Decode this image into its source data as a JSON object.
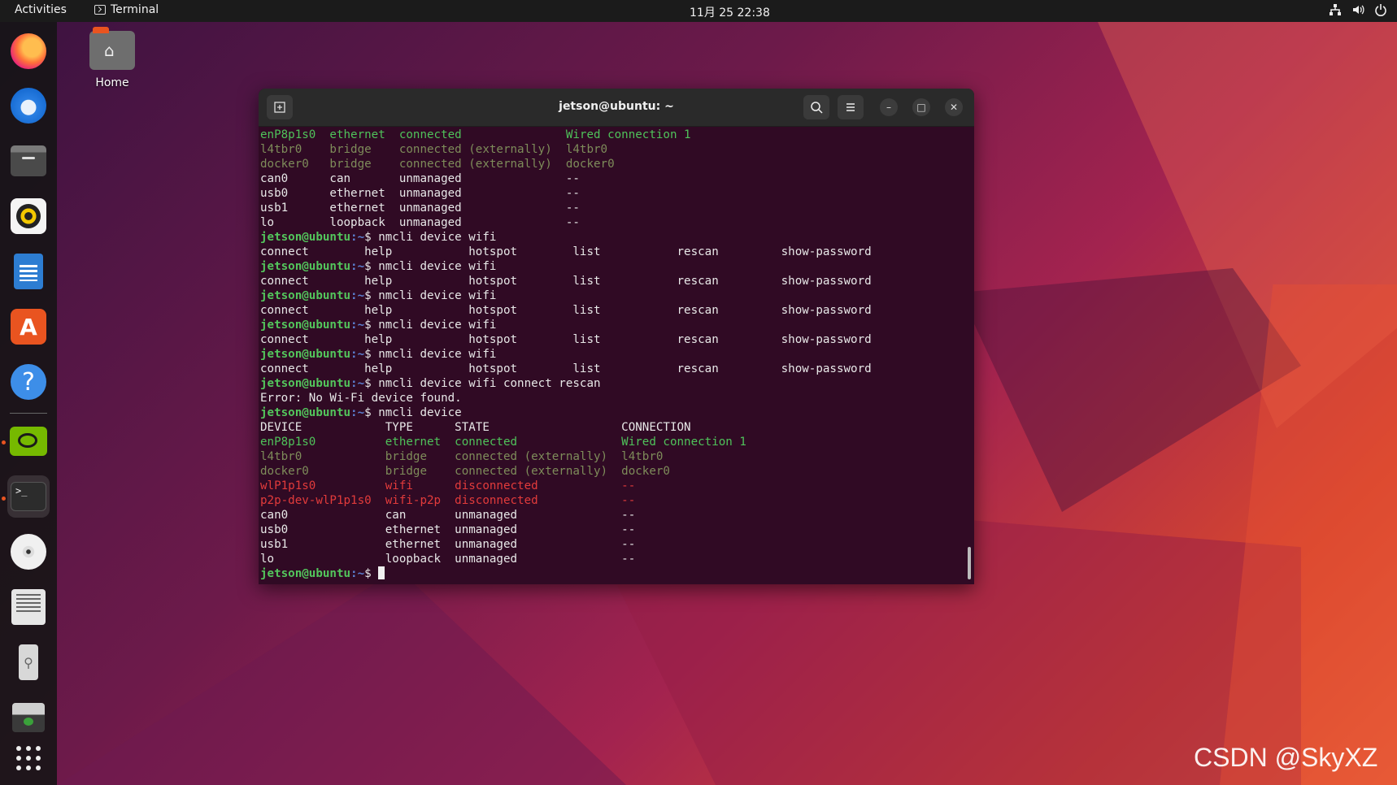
{
  "topbar": {
    "activities": "Activities",
    "app_name": "Terminal",
    "clock": "11月 25  22:38"
  },
  "desktop": {
    "home_label": "Home",
    "watermark": "CSDN @SkyXZ～"
  },
  "dock": {
    "items": [
      {
        "name": "firefox",
        "icon": "firefox-icon"
      },
      {
        "name": "thunderbird",
        "icon": "thunderbird-icon"
      },
      {
        "name": "files",
        "icon": "files-icon"
      },
      {
        "name": "rhythmbox",
        "icon": "rhythmbox-icon"
      },
      {
        "name": "libreoffice-writer",
        "icon": "writer-icon"
      },
      {
        "name": "app-center",
        "icon": "appstore-icon"
      },
      {
        "name": "help",
        "icon": "help-icon"
      },
      {
        "name": "nvidia-settings",
        "icon": "nvidia-icon"
      },
      {
        "name": "terminal",
        "icon": "terminal-icon",
        "active": true
      },
      {
        "name": "disc",
        "icon": "disc-icon"
      },
      {
        "name": "text-editor",
        "icon": "editor-icon"
      },
      {
        "name": "usb-drive",
        "icon": "usb-icon"
      },
      {
        "name": "drive",
        "icon": "drive-icon"
      },
      {
        "name": "show-apps",
        "icon": "grid-icon"
      }
    ],
    "accent": "#e95420"
  },
  "terminal": {
    "title": "jetson@ubuntu: ~",
    "prompt_user": "jetson@ubuntu",
    "prompt_path": ":~",
    "prompt_symbol": "$",
    "colors": {
      "background": "#300a24",
      "green": "#4fc25a",
      "dim": "#7e8c5a",
      "red": "#e23b3b"
    },
    "lines": [
      {
        "type": "row",
        "cols": [
          "enP8p1s0",
          "ethernet",
          "connected",
          "Wired connection 1"
        ],
        "color": "green",
        "widths": [
          10,
          10,
          24,
          0
        ]
      },
      {
        "type": "row",
        "cols": [
          "l4tbr0",
          "bridge",
          "connected (externally)",
          "l4tbr0"
        ],
        "color": "dim",
        "widths": [
          10,
          10,
          24,
          0
        ]
      },
      {
        "type": "row",
        "cols": [
          "docker0",
          "bridge",
          "connected (externally)",
          "docker0"
        ],
        "color": "dim",
        "widths": [
          10,
          10,
          24,
          0
        ]
      },
      {
        "type": "row",
        "cols": [
          "can0",
          "can",
          "unmanaged",
          "--"
        ],
        "color": "plain",
        "widths": [
          10,
          10,
          24,
          0
        ]
      },
      {
        "type": "row",
        "cols": [
          "usb0",
          "ethernet",
          "unmanaged",
          "--"
        ],
        "color": "plain",
        "widths": [
          10,
          10,
          24,
          0
        ]
      },
      {
        "type": "row",
        "cols": [
          "usb1",
          "ethernet",
          "unmanaged",
          "--"
        ],
        "color": "plain",
        "widths": [
          10,
          10,
          24,
          0
        ]
      },
      {
        "type": "row",
        "cols": [
          "lo",
          "loopback",
          "unmanaged",
          "--"
        ],
        "color": "plain",
        "widths": [
          10,
          10,
          24,
          0
        ]
      },
      {
        "type": "prompt",
        "cmd": "nmcli device wifi"
      },
      {
        "type": "row",
        "cols": [
          "connect",
          "help",
          "hotspot",
          "list",
          "rescan",
          "show-password"
        ],
        "color": "plain",
        "widths": [
          15,
          15,
          15,
          15,
          15,
          0
        ]
      },
      {
        "type": "prompt",
        "cmd": "nmcli device wifi"
      },
      {
        "type": "row",
        "cols": [
          "connect",
          "help",
          "hotspot",
          "list",
          "rescan",
          "show-password"
        ],
        "color": "plain",
        "widths": [
          15,
          15,
          15,
          15,
          15,
          0
        ]
      },
      {
        "type": "prompt",
        "cmd": "nmcli device wifi"
      },
      {
        "type": "row",
        "cols": [
          "connect",
          "help",
          "hotspot",
          "list",
          "rescan",
          "show-password"
        ],
        "color": "plain",
        "widths": [
          15,
          15,
          15,
          15,
          15,
          0
        ]
      },
      {
        "type": "prompt",
        "cmd": "nmcli device wifi"
      },
      {
        "type": "row",
        "cols": [
          "connect",
          "help",
          "hotspot",
          "list",
          "rescan",
          "show-password"
        ],
        "color": "plain",
        "widths": [
          15,
          15,
          15,
          15,
          15,
          0
        ]
      },
      {
        "type": "prompt",
        "cmd": "nmcli device wifi"
      },
      {
        "type": "row",
        "cols": [
          "connect",
          "help",
          "hotspot",
          "list",
          "rescan",
          "show-password"
        ],
        "color": "plain",
        "widths": [
          15,
          15,
          15,
          15,
          15,
          0
        ]
      },
      {
        "type": "prompt",
        "cmd": "nmcli device wifi connect rescan"
      },
      {
        "type": "text",
        "text": "Error: No Wi-Fi device found.",
        "color": "plain"
      },
      {
        "type": "prompt",
        "cmd": "nmcli device"
      },
      {
        "type": "row",
        "cols": [
          "DEVICE",
          "TYPE",
          "STATE",
          "CONNECTION"
        ],
        "color": "plain",
        "widths": [
          18,
          10,
          24,
          0
        ]
      },
      {
        "type": "row",
        "cols": [
          "enP8p1s0",
          "ethernet",
          "connected",
          "Wired connection 1"
        ],
        "color": "green",
        "widths": [
          18,
          10,
          24,
          0
        ]
      },
      {
        "type": "row",
        "cols": [
          "l4tbr0",
          "bridge",
          "connected (externally)",
          "l4tbr0"
        ],
        "color": "dim",
        "widths": [
          18,
          10,
          24,
          0
        ]
      },
      {
        "type": "row",
        "cols": [
          "docker0",
          "bridge",
          "connected (externally)",
          "docker0"
        ],
        "color": "dim",
        "widths": [
          18,
          10,
          24,
          0
        ]
      },
      {
        "type": "row",
        "cols": [
          "wlP1p1s0",
          "wifi",
          "disconnected",
          "--"
        ],
        "color": "red",
        "widths": [
          18,
          10,
          24,
          0
        ]
      },
      {
        "type": "row",
        "cols": [
          "p2p-dev-wlP1p1s0",
          "wifi-p2p",
          "disconnected",
          "--"
        ],
        "color": "red",
        "widths": [
          18,
          10,
          24,
          0
        ]
      },
      {
        "type": "row",
        "cols": [
          "can0",
          "can",
          "unmanaged",
          "--"
        ],
        "color": "plain",
        "widths": [
          18,
          10,
          24,
          0
        ]
      },
      {
        "type": "row",
        "cols": [
          "usb0",
          "ethernet",
          "unmanaged",
          "--"
        ],
        "color": "plain",
        "widths": [
          18,
          10,
          24,
          0
        ]
      },
      {
        "type": "row",
        "cols": [
          "usb1",
          "ethernet",
          "unmanaged",
          "--"
        ],
        "color": "plain",
        "widths": [
          18,
          10,
          24,
          0
        ]
      },
      {
        "type": "row",
        "cols": [
          "lo",
          "loopback",
          "unmanaged",
          "--"
        ],
        "color": "plain",
        "widths": [
          18,
          10,
          24,
          0
        ]
      },
      {
        "type": "prompt",
        "cmd": "",
        "cursor": true
      }
    ]
  }
}
